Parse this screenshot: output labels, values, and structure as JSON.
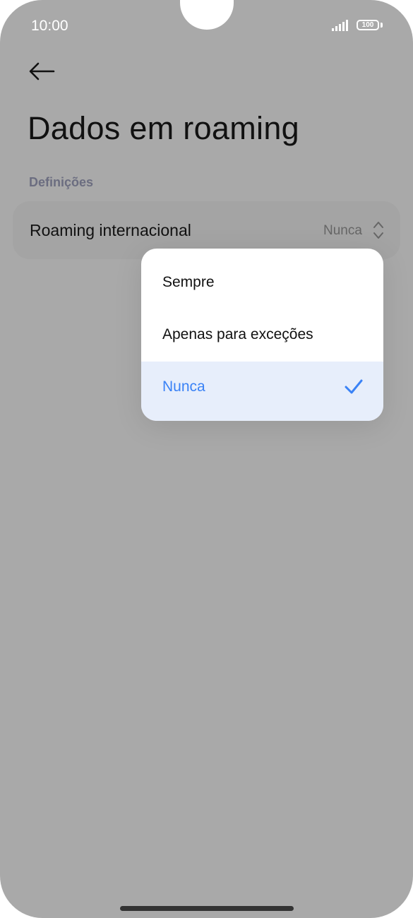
{
  "status_bar": {
    "time": "10:00",
    "battery": "100"
  },
  "header": {
    "title": "Dados em roaming"
  },
  "section": {
    "label": "Definições"
  },
  "setting_row": {
    "label": "Roaming internacional",
    "value": "Nunca"
  },
  "dropdown": {
    "options": [
      {
        "label": "Sempre",
        "selected": false
      },
      {
        "label": "Apenas para exceções",
        "selected": false
      },
      {
        "label": "Nunca",
        "selected": true
      }
    ]
  },
  "colors": {
    "accent": "#3a82f6",
    "selected_bg": "#e7eefb",
    "overlay": "#a9a9a9"
  },
  "icons": [
    "back-arrow-icon",
    "signal-icon",
    "battery-icon",
    "up-down-chevron-icon",
    "checkmark-icon"
  ]
}
